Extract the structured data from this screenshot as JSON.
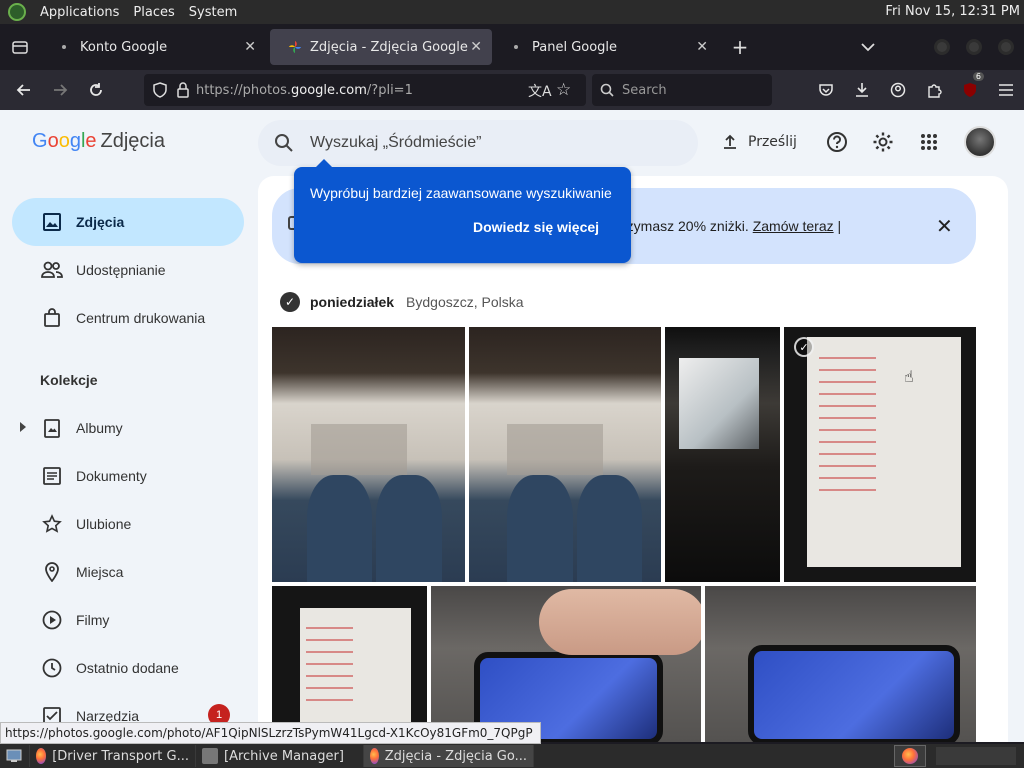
{
  "top_panel": {
    "menus": [
      "Applications",
      "Places",
      "System"
    ],
    "clock": "Fri Nov 15, 12:31 PM"
  },
  "browser": {
    "tabs": [
      {
        "title": "Konto Google",
        "active": false
      },
      {
        "title": "Zdjęcia - Zdjęcia Google",
        "active": true
      },
      {
        "title": "Panel Google",
        "active": false
      }
    ],
    "url_prefix": "https://photos.",
    "url_domain": "google.com",
    "url_suffix": "/?pli=1",
    "search_placeholder": "Search",
    "extension_badge": "6"
  },
  "photos": {
    "logo_google": [
      "G",
      "o",
      "o",
      "g",
      "l",
      "e"
    ],
    "logo_product": "Zdjęcia",
    "search_text": "Wyszukaj „Śródmieście”",
    "upload_label": "Prześlij",
    "sidebar": {
      "items": [
        {
          "label": "Zdjęcia",
          "icon": "photo-icon",
          "active": true
        },
        {
          "label": "Udostępnianie",
          "icon": "people-icon"
        },
        {
          "label": "Centrum drukowania",
          "icon": "shopping-bag-icon"
        }
      ],
      "section": "Kolekcje",
      "collections": [
        {
          "label": "Albumy",
          "icon": "album-icon"
        },
        {
          "label": "Dokumenty",
          "icon": "document-icon"
        },
        {
          "label": "Ulubione",
          "icon": "star-icon"
        },
        {
          "label": "Miejsca",
          "icon": "location-pin-icon"
        },
        {
          "label": "Filmy",
          "icon": "play-icon"
        },
        {
          "label": "Ostatnio dodane",
          "icon": "clock-icon"
        },
        {
          "label": "Narzędzia",
          "icon": "tools-icon",
          "badge": "1"
        }
      ]
    },
    "promo": {
      "text_before_link": "rzymasz 20% zniżki. ",
      "link": "Zamów teraz",
      "text_after_link": " |"
    },
    "popover": {
      "message": "Wypróbuj bardziej zaawansowane wyszukiwanie",
      "action": "Dowiedz się więcej"
    },
    "group": {
      "day": "poniedziałek",
      "location": "Bydgoszcz, Polska"
    }
  },
  "status_url": "https://photos.google.com/photo/AF1QipNlSLzrzTsPymW41Lgcd-X1KcOy81GFm0_7QPgP",
  "taskbar": {
    "tasks": [
      {
        "label": "[Driver Transport G...",
        "icon": "firefox-icon"
      },
      {
        "label": "[Archive Manager]",
        "icon": "archive-icon"
      },
      {
        "label": "Zdjęcia - Zdjęcia Go...",
        "icon": "firefox-icon",
        "active": true
      }
    ]
  }
}
